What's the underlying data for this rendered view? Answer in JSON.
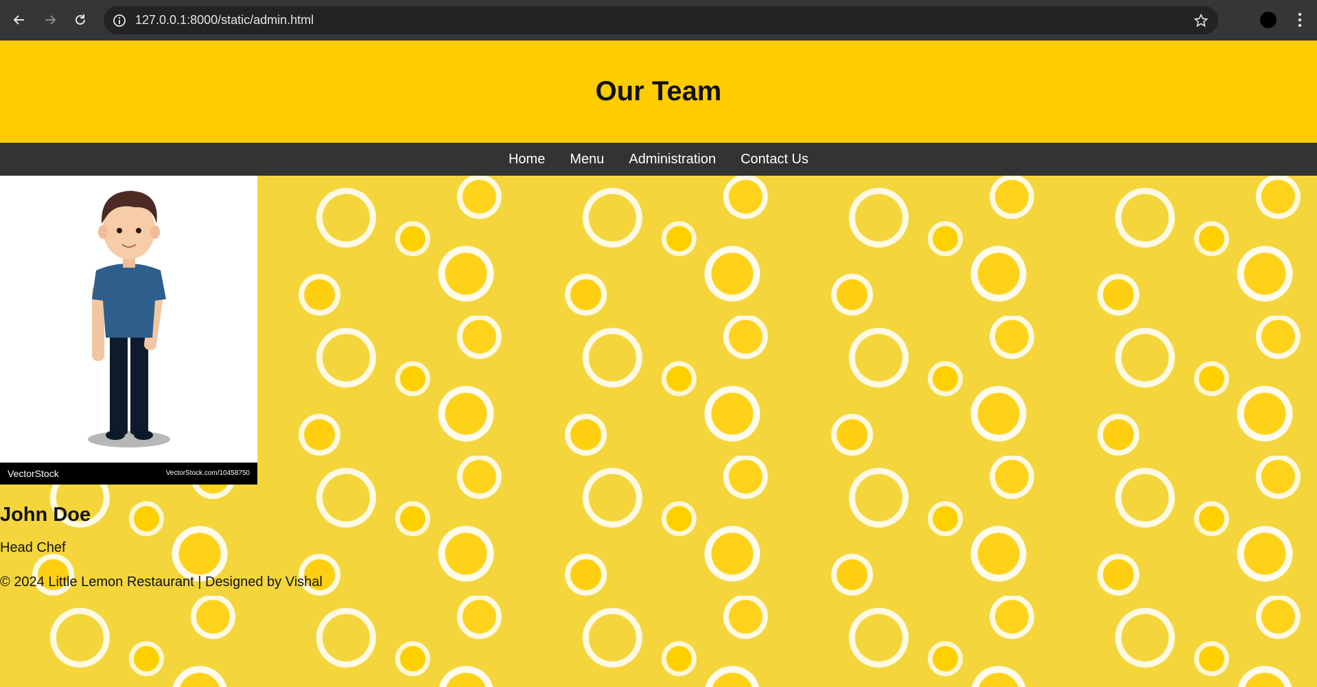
{
  "browser": {
    "url": "127.0.0.1:8000/static/admin.html",
    "icons": [
      "back-icon",
      "forward-icon",
      "reload-icon",
      "site-info-icon",
      "bookmark-star-icon",
      "profile-avatar",
      "menu-kebab-icon"
    ]
  },
  "header": {
    "title": "Our Team"
  },
  "nav": {
    "items": [
      "Home",
      "Menu",
      "Administration",
      "Contact Us"
    ]
  },
  "team": {
    "members": [
      {
        "name": "John Doe",
        "role": "Head Chef",
        "photo_caption_brand": "VectorStock",
        "photo_caption_ref": "VectorStock.com/10458750"
      }
    ]
  },
  "footer": {
    "text": "© 2024 Little Lemon Restaurant | Designed by Vishal"
  },
  "colors": {
    "header": "#ffcc00",
    "nav": "#333333",
    "background": "#f4d53b"
  }
}
